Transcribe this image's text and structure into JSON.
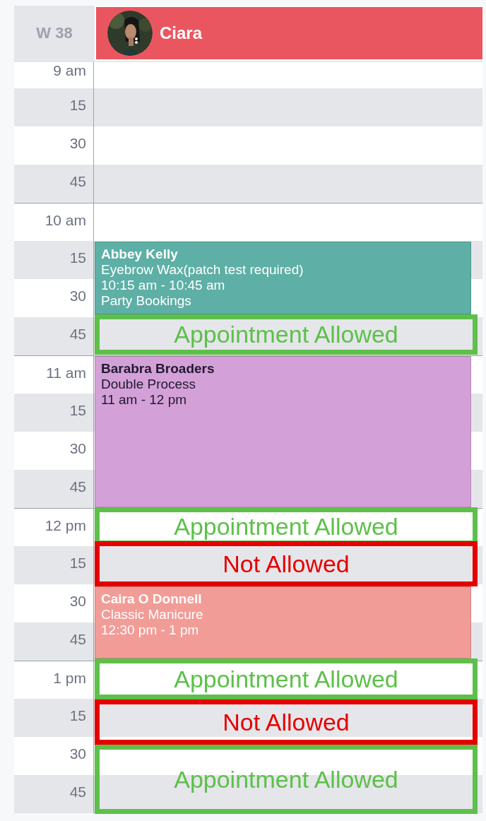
{
  "header": {
    "week": "W 38",
    "staff": {
      "name": "Ciara",
      "color": "#ea5660"
    }
  },
  "time_slots": [
    {
      "label": "9 am"
    },
    {
      "label": "15"
    },
    {
      "label": "30"
    },
    {
      "label": "45"
    },
    {
      "label": "10 am"
    },
    {
      "label": "15"
    },
    {
      "label": "30"
    },
    {
      "label": "45"
    },
    {
      "label": "11 am"
    },
    {
      "label": "15"
    },
    {
      "label": "30"
    },
    {
      "label": "45"
    },
    {
      "label": "12 pm"
    },
    {
      "label": "15"
    },
    {
      "label": "30"
    },
    {
      "label": "45"
    },
    {
      "label": "1 pm"
    },
    {
      "label": "15"
    },
    {
      "label": "30"
    },
    {
      "label": "45"
    }
  ],
  "appointments": [
    {
      "client": "Abbey Kelly",
      "lines": [
        "Eyebrow Wax(patch test required)",
        "10:15 am - 10:45 am",
        "Party Bookings"
      ],
      "color": "#5eafa5"
    },
    {
      "client": "Barabra Broaders",
      "lines": [
        "Double Process",
        "11 am - 12 pm"
      ],
      "color": "#d4a0d8"
    },
    {
      "client": "Caira O Donnell",
      "lines": [
        "Classic Manicure",
        "12:30 pm - 1 pm"
      ],
      "color": "#f29c97"
    }
  ],
  "markers": [
    {
      "kind": "allowed",
      "label": "Appointment Allowed"
    },
    {
      "kind": "allowed",
      "label": "Appointment Allowed"
    },
    {
      "kind": "not_allowed",
      "label": "Not Allowed"
    },
    {
      "kind": "allowed",
      "label": "Appointment Allowed"
    },
    {
      "kind": "not_allowed",
      "label": "Not Allowed"
    },
    {
      "kind": "allowed",
      "label": "Appointment Allowed"
    }
  ]
}
